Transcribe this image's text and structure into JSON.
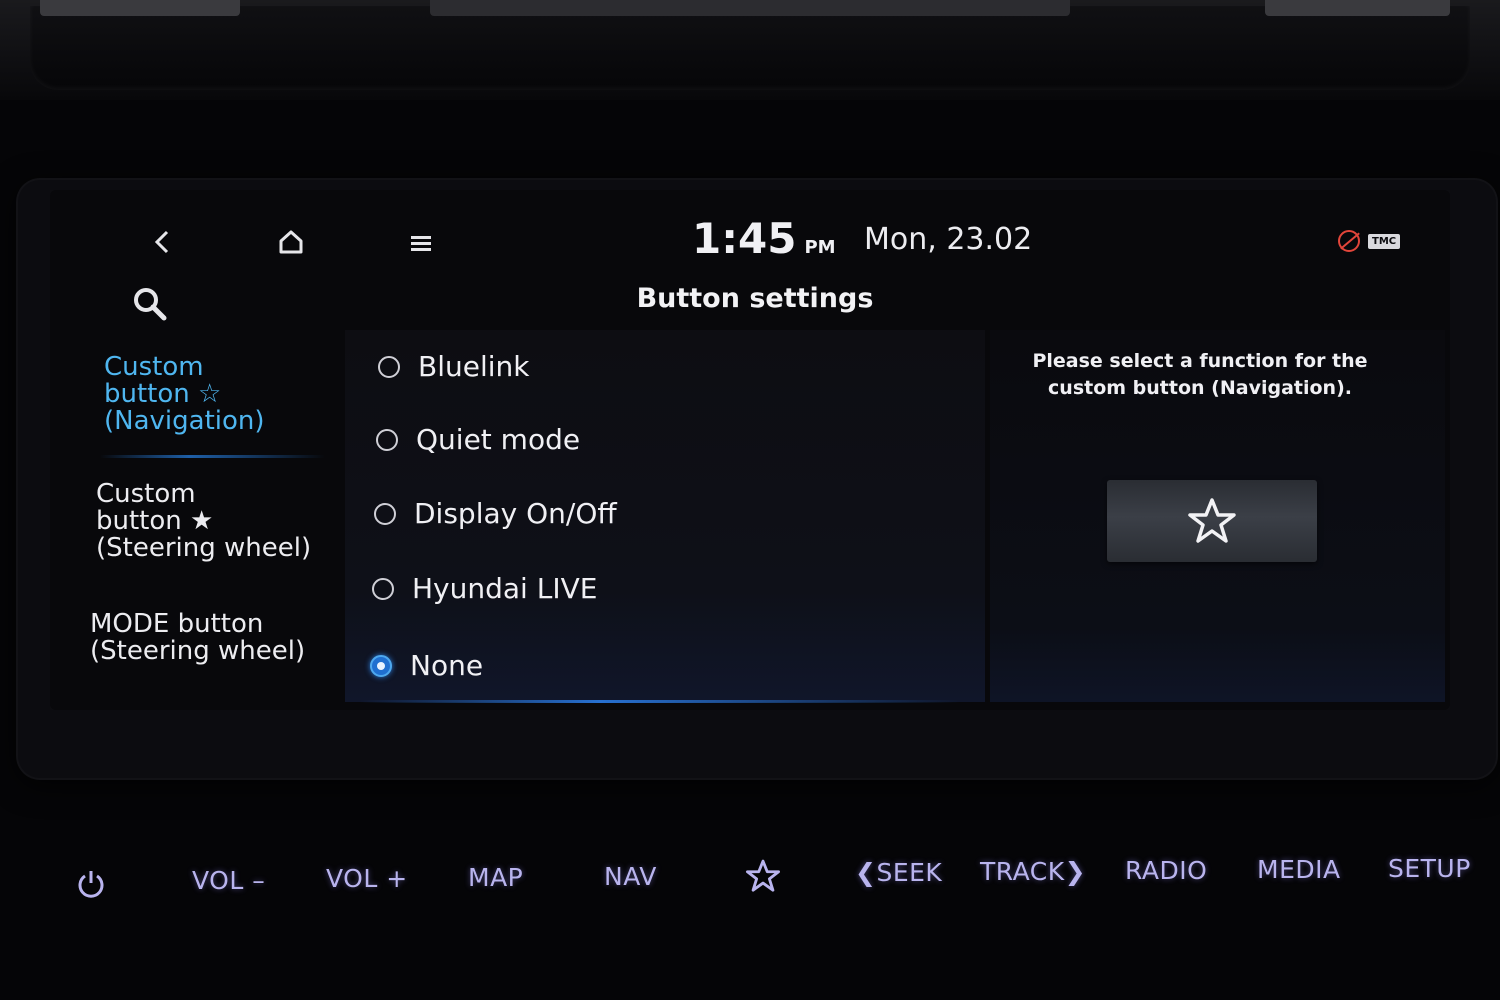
{
  "status_bar": {
    "time": "1:45",
    "ampm": "PM",
    "date": "Mon, 23.02",
    "tmc_label": "TMC"
  },
  "page": {
    "title": "Button settings"
  },
  "menu": {
    "items": [
      {
        "label": "Custom\nbutton ☆\n(Navigation)",
        "active": true
      },
      {
        "label": "Custom\nbutton ★\n(Steering wheel)",
        "active": false
      },
      {
        "label": "MODE button\n(Steering wheel)",
        "active": false
      }
    ]
  },
  "options": {
    "items": [
      {
        "label": "Bluelink",
        "selected": false
      },
      {
        "label": "Quiet mode",
        "selected": false
      },
      {
        "label": "Display On/Off",
        "selected": false
      },
      {
        "label": "Hyundai LIVE",
        "selected": false
      },
      {
        "label": "None",
        "selected": true
      }
    ]
  },
  "preview": {
    "prompt": "Please select a function for the custom button (Navigation)."
  },
  "hardkeys": {
    "vol_down": "VOL –",
    "vol_up": "VOL +",
    "map": "MAP",
    "nav": "NAV",
    "seek": "❮SEEK",
    "track": "TRACK❯",
    "radio": "RADIO",
    "media": "MEDIA",
    "setup": "SETUP"
  },
  "colors": {
    "accent_blue": "#4fb6f0",
    "hardkey_purple": "#b9b4ee",
    "bluetooth_red": "#e2453a"
  }
}
